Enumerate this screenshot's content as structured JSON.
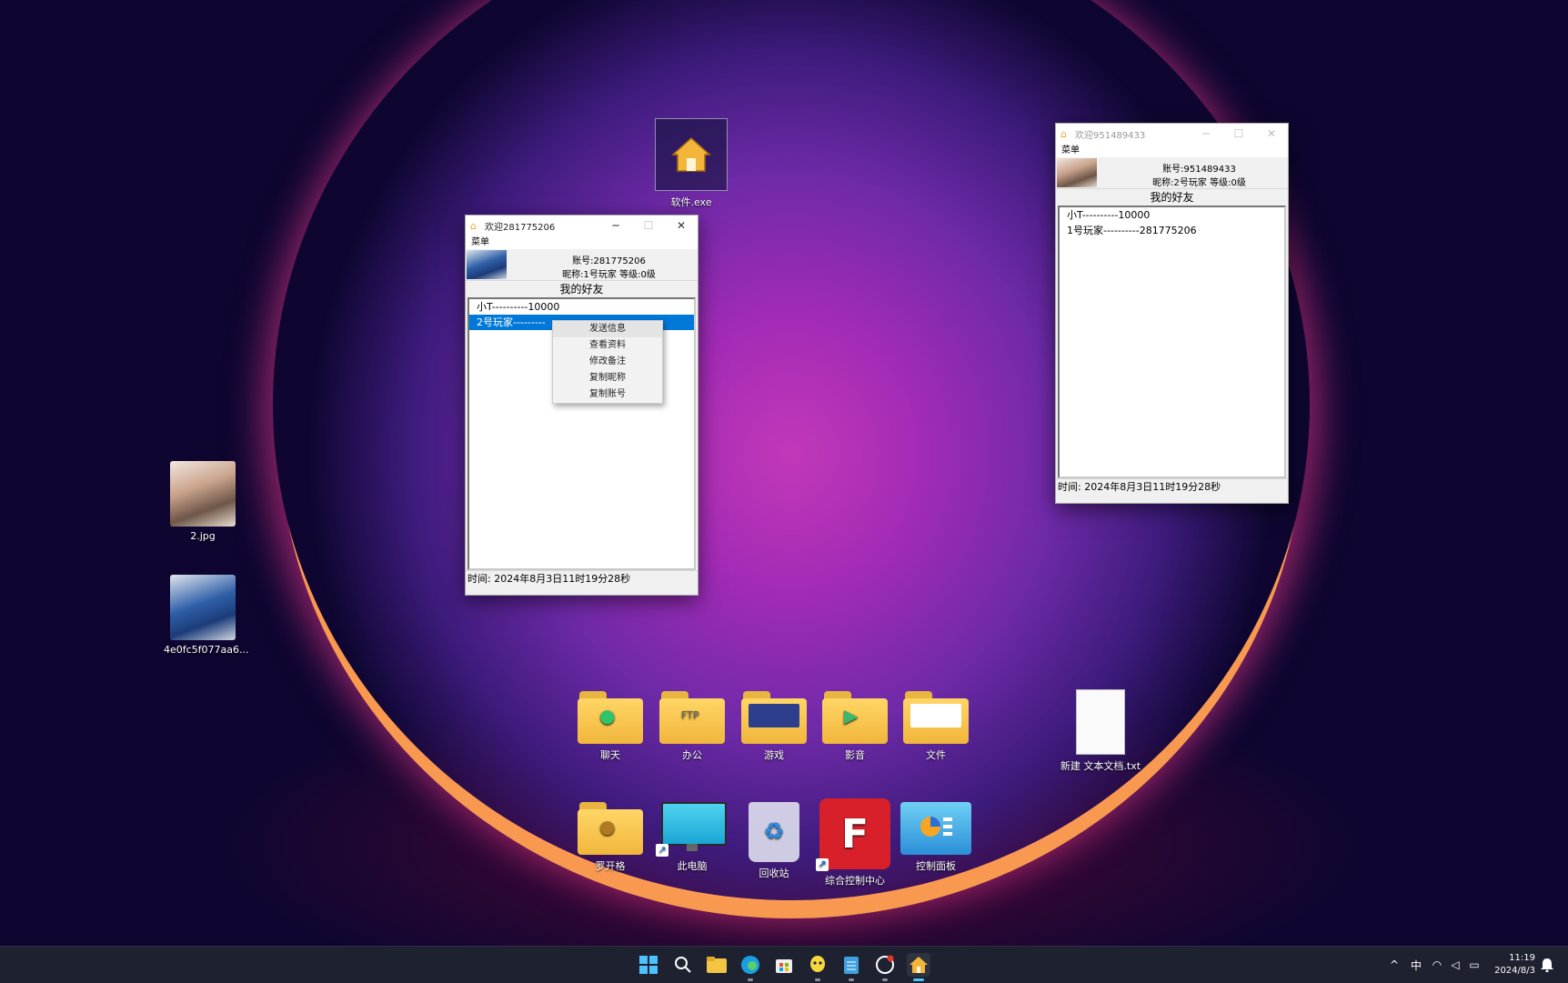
{
  "desktop": {
    "icons": {
      "software": "软件.exe",
      "photo1": "2.jpg",
      "photo2": "4e0fc5f077aa6...",
      "chat": "聊天",
      "office": "办公",
      "games": "游戏",
      "media": "影音",
      "files": "文件",
      "textdoc": "新建 文本文档.txt",
      "user": "罗开格",
      "thispc": "此电脑",
      "recycle": "回收站",
      "control_center": "综合控制中心",
      "control_panel": "控制面板"
    }
  },
  "window1": {
    "title": "欢迎281775206",
    "menu": "菜单",
    "account": "账号:281775206",
    "nickname_level": "昵称:1号玩家    等级:0级",
    "friends_title": "我的好友",
    "friends": [
      "小T----------10000",
      "2号玩家---------"
    ],
    "status": "时间: 2024年8月3日11时19分28秒",
    "context_menu": [
      "发送信息",
      "查看资料",
      "修改备注",
      "复制昵称",
      "复制账号"
    ]
  },
  "window2": {
    "title": "欢迎951489433",
    "menu": "菜单",
    "account": "账号:951489433",
    "nickname_level": "昵称:2号玩家    等级:0级",
    "friends_title": "我的好友",
    "friends": [
      "小T----------10000",
      "1号玩家----------281775206"
    ],
    "status": "时间: 2024年8月3日11时19分28秒"
  },
  "taskbar": {
    "ime": "中",
    "time": "11:19",
    "date": "2024/8/3"
  },
  "colors": {
    "selection": "#0078d7",
    "desktop_bg": "#0e0630",
    "taskbar_bg": "#1e2130"
  }
}
